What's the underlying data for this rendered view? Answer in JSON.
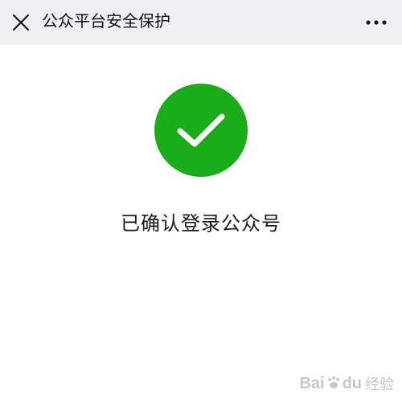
{
  "nav": {
    "title": "公众平台安全保护",
    "close_icon": "close-icon",
    "more_icon": "more-dots-icon",
    "background": "#efeff4"
  },
  "status": {
    "icon": "check-icon",
    "circle_color": "#1aad19",
    "text": "已确认登录公众号"
  },
  "watermark": {
    "brand": "Bai",
    "brand2": "du",
    "sub": "经验",
    "icon": "baidu-paw-icon"
  }
}
